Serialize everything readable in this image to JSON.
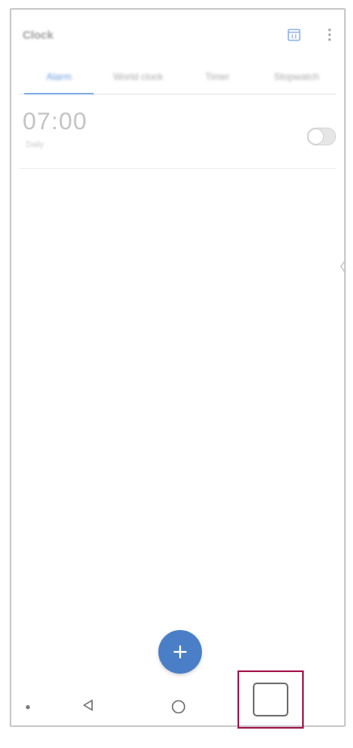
{
  "app_bar": {
    "title": "Clock",
    "calendar_icon": "calendar-icon",
    "more_icon": "more-vert-icon"
  },
  "tabs": [
    {
      "label": "Alarm",
      "active": true
    },
    {
      "label": "World clock",
      "active": false
    },
    {
      "label": "Timer",
      "active": false
    },
    {
      "label": "Stopwatch",
      "active": false
    }
  ],
  "alarm": {
    "time": "07:00",
    "subtitle": "Daily",
    "enabled": false
  },
  "fab": {
    "icon": "plus-icon",
    "color": "#4a7fc8"
  },
  "nav_bar": {
    "back_icon": "back-triangle-icon",
    "home_icon": "home-circle-icon",
    "recents_icon": "recents-square-icon",
    "highlight_color": "#a4164d"
  }
}
